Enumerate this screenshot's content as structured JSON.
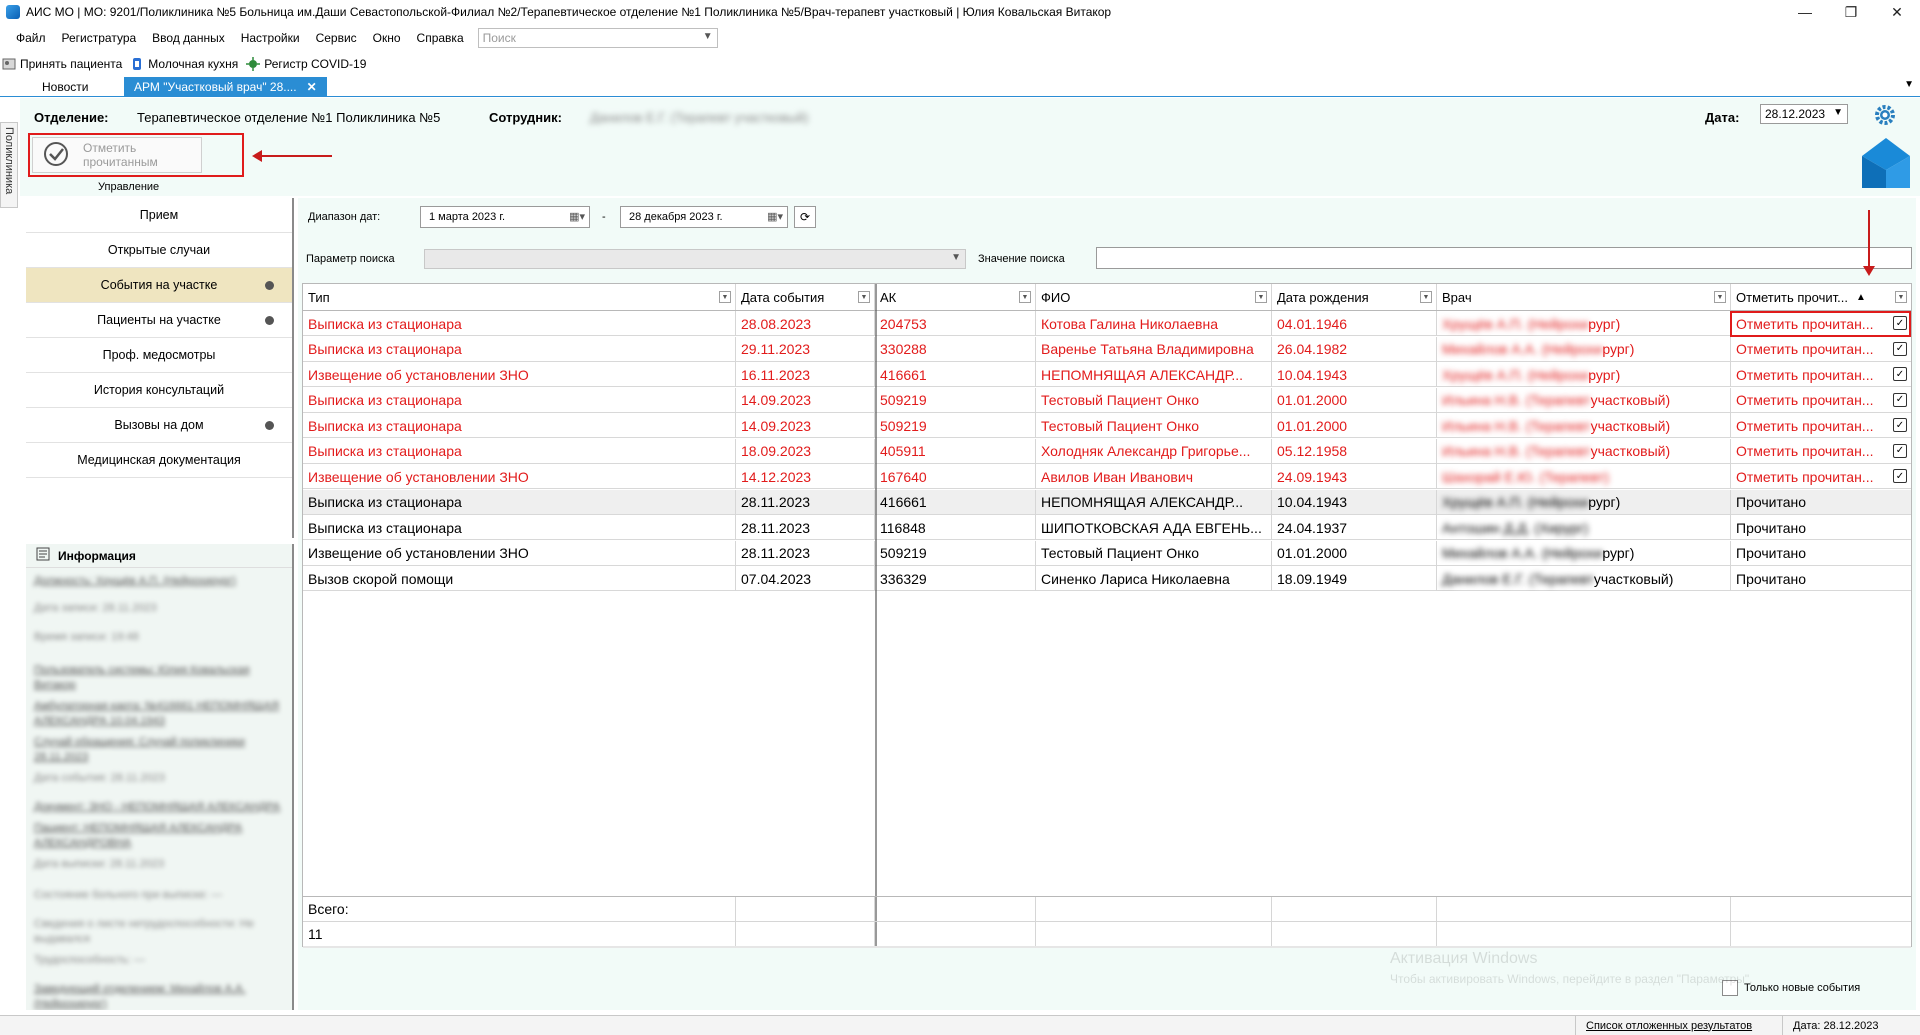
{
  "window": {
    "title": "АИС МО | МО: 9201/Поликлиника №5 Больница им.Даши Севастопольской-Филиал №2/Терапевтическое отделение №1 Поликлиника №5/Врач-терапевт участковый | Юлия Ковальская Витакор",
    "controls": {
      "minimize": "—",
      "restore": "❐",
      "close": "✕"
    }
  },
  "menu": {
    "items": [
      "Файл",
      "Регистратура",
      "Ввод данных",
      "Настройки",
      "Сервис",
      "Окно",
      "Справка"
    ],
    "search_placeholder": "Поиск"
  },
  "quickbar": {
    "items": [
      "Принять пациента",
      "Молочная кухня",
      "Регистр COVID-19"
    ]
  },
  "tabs": {
    "items": [
      "Новости",
      "АРМ \"Участковый врач\" 28...."
    ],
    "active_index": 1
  },
  "side_strip_label": "Поликлиника",
  "header": {
    "department_label": "Отделение:",
    "department_value": "Терапевтическое отделение №1 Поликлиника №5",
    "employee_label": "Сотрудник:",
    "employee_value": "Данилов Е.Г. (Терапевт участковый)",
    "date_label": "Дата:",
    "date_value": "28.12.2023",
    "mark_read_button": "Отметить прочитанным",
    "management_label": "Управление"
  },
  "nav": {
    "items": [
      {
        "label": "Прием",
        "dot": false
      },
      {
        "label": "Открытые случаи",
        "dot": false
      },
      {
        "label": "События на участке",
        "dot": true,
        "active": true
      },
      {
        "label": "Пациенты на участке",
        "dot": true
      },
      {
        "label": "Проф. медосмотры",
        "dot": false
      },
      {
        "label": "История консультаций",
        "dot": false
      },
      {
        "label": "Вызовы на дом",
        "dot": true
      },
      {
        "label": "Медицинская документация",
        "dot": false
      }
    ]
  },
  "info": {
    "title": "Информация",
    "lines": [
      "Должность: Хрущёв А.П. (Нейрохирург)",
      "Дата записи: 28.11.2023",
      "Время записи: 19:48",
      "Пользователь системы: Юлия Ковальская Витакор",
      "Амбулаторная карта: №416661 НЕПОМНЯЩАЯ АЛЕКСАНДРА 10.04.1943",
      "Случай обращения: Случай поликлиники 28.11.2023",
      "Дата события: 28.11.2023",
      "Документ: ЗНО - НЕПОМНЯЩАЯ АЛЕКСАНДРА",
      "Пациент: НЕПОМНЯЩАЯ АЛЕКСАНДРА АЛЕКСАНДРОВНА",
      "Дата выписки: 28.11.2023",
      "Состояние больного при выписке: —",
      "Сведения о листе нетрудоспособности: Не выдавался",
      "Трудоспособность: —",
      "Заведующий отделением: Михайлов А.А. (Нейрохирург)"
    ]
  },
  "filters": {
    "date_range_label": "Диапазон дат:",
    "date_from": "1   марта   2023 г.",
    "date_separator": "-",
    "date_to": "28  декабря  2023 г.",
    "search_param_label": "Параметр поиска",
    "search_value_label": "Значение поиска"
  },
  "grid": {
    "columns": [
      "Тип",
      "Дата события",
      "АК",
      "ФИО",
      "Дата рождения",
      "Врач",
      "Отметить прочит..."
    ],
    "sort_indicator": "▲",
    "rows": [
      {
        "type": "Выписка из стационара",
        "date": "28.08.2023",
        "ak": "204753",
        "fio": "Котова Галина Николаевна",
        "dob": "04.01.1946",
        "doctor_hidden": "Хрущёв А.П. (Нейрохи",
        "doctor_visible": "рург)",
        "action": "Отметить прочитан...",
        "unread": true
      },
      {
        "type": "Выписка из стационара",
        "date": "29.11.2023",
        "ak": "330288",
        "fio": "Варенье Татьяна Владимировна",
        "dob": "26.04.1982",
        "doctor_hidden": "Михайлов А.А. (Нейрохи",
        "doctor_visible": "рург)",
        "action": "Отметить прочитан...",
        "unread": true
      },
      {
        "type": "Извещение об установлении ЗНО",
        "date": "16.11.2023",
        "ak": "416661",
        "fio": "НЕПОМНЯЩАЯ АЛЕКСАНДР...",
        "dob": "10.04.1943",
        "doctor_hidden": "Хрущёв А.П. (Нейрохи",
        "doctor_visible": "рург)",
        "action": "Отметить прочитан...",
        "unread": true
      },
      {
        "type": "Выписка из стационара",
        "date": "14.09.2023",
        "ak": "509219",
        "fio": "Тестовый Пациент Онко",
        "dob": "01.01.2000",
        "doctor_hidden": "Ильина Н.В. (Терапевт",
        "doctor_visible": " участковый)",
        "action": "Отметить прочитан...",
        "unread": true
      },
      {
        "type": "Выписка из стационара",
        "date": "14.09.2023",
        "ak": "509219",
        "fio": "Тестовый Пациент Онко",
        "dob": "01.01.2000",
        "doctor_hidden": "Ильина Н.В. (Терапевт",
        "doctor_visible": " участковый)",
        "action": "Отметить прочитан...",
        "unread": true
      },
      {
        "type": "Выписка из стационара",
        "date": "18.09.2023",
        "ak": "405911",
        "fio": "Холодняк Александр Григорье...",
        "dob": "05.12.1958",
        "doctor_hidden": "Ильина Н.В. (Терапевт",
        "doctor_visible": " участковый)",
        "action": "Отметить прочитан...",
        "unread": true
      },
      {
        "type": "Извещение об установлении ЗНО",
        "date": "14.12.2023",
        "ak": "167640",
        "fio": "Авилов Иван Иванович",
        "dob": "24.09.1943",
        "doctor_hidden": "Шахорай Е.Ю. (Терапевт)",
        "doctor_visible": "",
        "action": "Отметить прочитан...",
        "unread": true
      },
      {
        "type": "Выписка из стационара",
        "date": "28.11.2023",
        "ak": "416661",
        "fio": "НЕПОМНЯЩАЯ АЛЕКСАНДР...",
        "dob": "10.04.1943",
        "doctor_hidden": "Хрущёв А.П. (Нейрохи",
        "doctor_visible": "рург)",
        "action": "Прочитано",
        "unread": false
      },
      {
        "type": "Выписка из стационара",
        "date": "28.11.2023",
        "ak": "116848",
        "fio": "ШИПОТКОВСКАЯ АДА ЕВГЕНЬ...",
        "dob": "24.04.1937",
        "doctor_hidden": "Антошин Д.Д. (Хирург)",
        "doctor_visible": "",
        "action": "Прочитано",
        "unread": false
      },
      {
        "type": "Извещение об установлении ЗНО",
        "date": "28.11.2023",
        "ak": "509219",
        "fio": "Тестовый Пациент Онко",
        "dob": "01.01.2000",
        "doctor_hidden": "Михайлов А.А. (Нейрохи",
        "doctor_visible": "рург)",
        "action": "Прочитано",
        "unread": false
      },
      {
        "type": "Вызов скорой помощи",
        "date": "07.04.2023",
        "ak": "336329",
        "fio": "Синенко Лариса Николаевна",
        "dob": "18.09.1949",
        "doctor_hidden": "Данилов Е.Г. (Терапевт",
        "doctor_visible": " участковый)",
        "action": "Прочитано",
        "unread": false
      }
    ],
    "total_label": "Всего:",
    "total_value": "11"
  },
  "bottom": {
    "new_only_label": "Только новые события",
    "watermark_line1": "Активация Windows",
    "watermark_line2": "Чтобы активировать Windows, перейдите в раздел \"Параметры\"."
  },
  "statusbar": {
    "deferred_link": "Список отложенных результатов",
    "date_text": "Дата: 28.12.2023"
  },
  "colors": {
    "accent": "#2a8dd4",
    "unread_text": "#e21b1b",
    "highlight_box": "#e01b1b",
    "panel_bg": "#f2fbf8",
    "active_nav": "#efe5c0"
  }
}
